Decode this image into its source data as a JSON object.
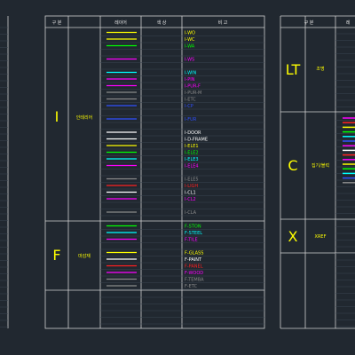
{
  "colors": {
    "background": "#212830",
    "grid": "#d0d0d0",
    "grid_minor": "#3a4450",
    "header_text": "#e8e8e8",
    "category_text": "#ffff00"
  },
  "table_left": {
    "headers": [
      "구 분",
      "레이어",
      "색 상",
      "비 고"
    ],
    "sections": [
      {
        "letter": "I",
        "name": "인테리어",
        "layers": [
          {
            "name": "I-WO",
            "color": "#ffff00"
          },
          {
            "name": "I-WC",
            "color": "#ffff00"
          },
          {
            "name": "I-WA",
            "color": "#00ff00"
          },
          {
            "name": "",
            "color": ""
          },
          {
            "name": "I-WS",
            "color": "#ff00ff"
          },
          {
            "name": "",
            "color": ""
          },
          {
            "name": "I-WIN",
            "color": "#00ffff"
          },
          {
            "name": "I-PIN",
            "color": "#ff00ff"
          },
          {
            "name": "I-PUR-F",
            "color": "#ff00ff"
          },
          {
            "name": "I-PUR-M",
            "color": "#8a8a8a"
          },
          {
            "name": "I-ETC",
            "color": "#8a8a8a"
          },
          {
            "name": "I-CP",
            "color": "#3050ff"
          },
          {
            "name": "",
            "color": ""
          },
          {
            "name": "I-FUR",
            "color": "#3050ff"
          },
          {
            "name": "",
            "color": ""
          },
          {
            "name": "I-DOOR",
            "color": "#ffffff"
          },
          {
            "name": "I-D-FRAME",
            "color": "#ffffff"
          },
          {
            "name": "I-ELE1",
            "color": "#ffff00"
          },
          {
            "name": "I-ELE2",
            "color": "#00ff00"
          },
          {
            "name": "I-ELE3",
            "color": "#00ffff"
          },
          {
            "name": "I-ELE4",
            "color": "#ff00ff"
          },
          {
            "name": "",
            "color": ""
          },
          {
            "name": "I-ELE5",
            "color": "#8a8a8a"
          },
          {
            "name": "I-LIGH",
            "color": "#ff2020"
          },
          {
            "name": "I-CL1",
            "color": "#ffffff"
          },
          {
            "name": "I-CL2",
            "color": "#ff00ff"
          },
          {
            "name": "",
            "color": ""
          },
          {
            "name": "I-CLA",
            "color": "#8a8a8a"
          }
        ]
      },
      {
        "letter": "F",
        "name": "마감재",
        "layers": [
          {
            "name": "F-STON",
            "color": "#00ff00"
          },
          {
            "name": "F-STEEL",
            "color": "#00ffff"
          },
          {
            "name": "F-TILE",
            "color": "#ff00ff"
          },
          {
            "name": "",
            "color": ""
          },
          {
            "name": "F-GLASS",
            "color": "#ffff00"
          },
          {
            "name": "F-PAINT",
            "color": "#ffffff"
          },
          {
            "name": "F-PANEL",
            "color": "#ff2020"
          },
          {
            "name": "F-WOOD",
            "color": "#ff00ff"
          },
          {
            "name": "F-TEMBA",
            "color": "#8a8a8a"
          },
          {
            "name": "F-ETC",
            "color": "#8a8a8a"
          }
        ]
      }
    ]
  },
  "table_right": {
    "headers": [
      "구 분",
      "레"
    ],
    "sections": [
      {
        "letter": "LT",
        "name": "조명"
      },
      {
        "letter": "C",
        "name": "집기/블럭"
      },
      {
        "letter": "X",
        "name": "XREF"
      }
    ],
    "swatches": [
      "#ff00ff",
      "#ff2020",
      "#ffff00",
      "#00ff00",
      "#00ffff",
      "#3050ff",
      "#ff00ff",
      "#ffffff",
      "#ff2020",
      "#ff00ff",
      "#ffff00",
      "#00ff00",
      "#00ffff",
      "#3050ff",
      "#8a8a8a"
    ]
  }
}
